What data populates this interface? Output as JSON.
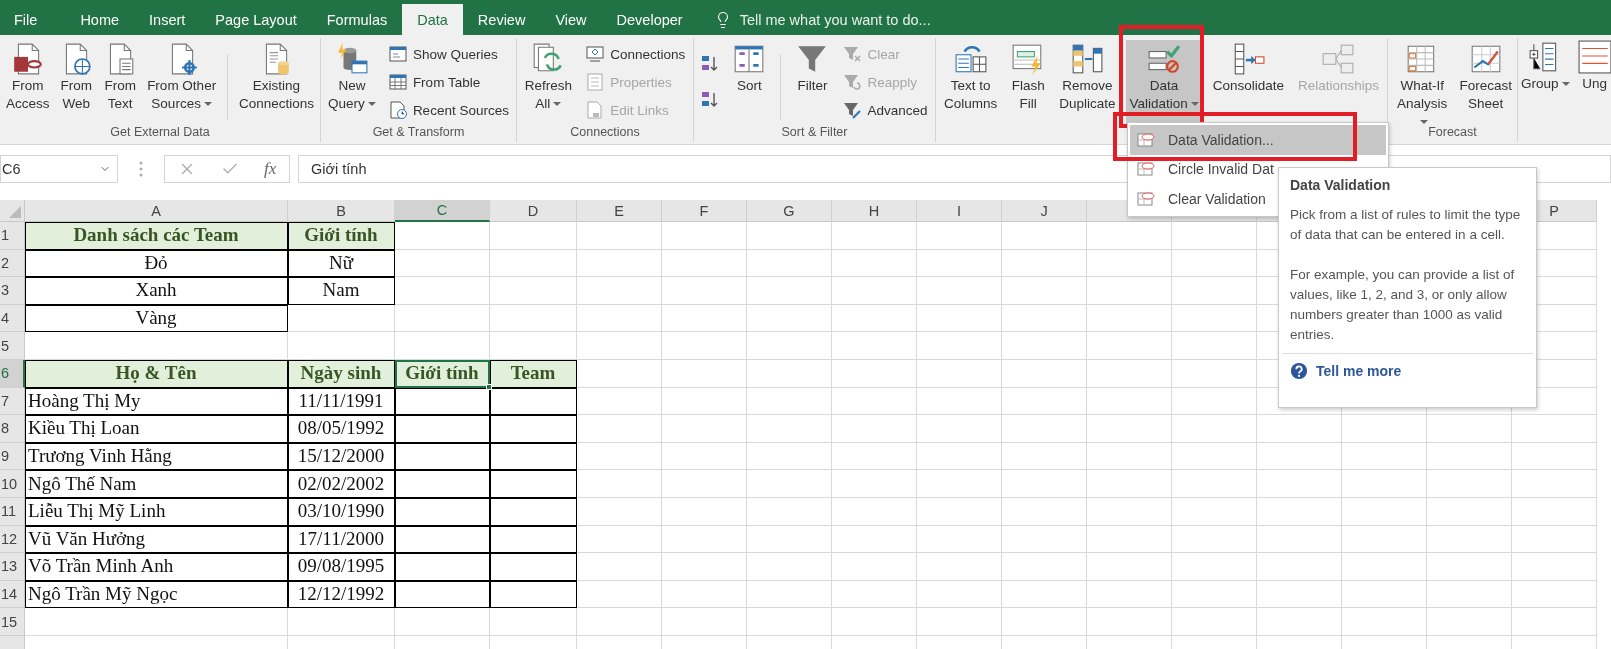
{
  "tabs": [
    {
      "label": "File",
      "selected": false
    },
    {
      "label": "Home",
      "selected": false
    },
    {
      "label": "Insert",
      "selected": false
    },
    {
      "label": "Page Layout",
      "selected": false
    },
    {
      "label": "Formulas",
      "selected": false
    },
    {
      "label": "Data",
      "selected": true
    },
    {
      "label": "Review",
      "selected": false
    },
    {
      "label": "View",
      "selected": false
    },
    {
      "label": "Developer",
      "selected": false
    }
  ],
  "tell_me": {
    "placeholder": "Tell me what you want to do..."
  },
  "ribbon": {
    "groups": [
      {
        "label": "Get External Data",
        "items": [
          {
            "kind": "large",
            "label": "From\nAccess",
            "dropdown": false,
            "disabled": false
          },
          {
            "kind": "large",
            "label": "From\nWeb",
            "dropdown": false,
            "disabled": false
          },
          {
            "kind": "large",
            "label": "From\nText",
            "dropdown": false,
            "disabled": false
          },
          {
            "kind": "large",
            "label": "From Other\nSources",
            "dropdown": true,
            "disabled": false
          },
          {
            "kind": "separator"
          },
          {
            "kind": "large",
            "label": "Existing\nConnections",
            "dropdown": false,
            "disabled": false
          }
        ]
      },
      {
        "label": "Get & Transform",
        "items": [
          {
            "kind": "large",
            "label": "New\nQuery",
            "dropdown": true,
            "disabled": false
          },
          {
            "kind": "stack",
            "items": [
              {
                "label": "Show Queries",
                "disabled": false
              },
              {
                "label": "From Table",
                "disabled": false
              },
              {
                "label": "Recent Sources",
                "disabled": false
              }
            ]
          }
        ]
      },
      {
        "label": "Connections",
        "items": [
          {
            "kind": "large",
            "label": "Refresh\nAll",
            "dropdown": true,
            "disabled": false
          },
          {
            "kind": "stack",
            "items": [
              {
                "label": "Connections",
                "disabled": false
              },
              {
                "label": "Properties",
                "disabled": true
              },
              {
                "label": "Edit Links",
                "disabled": true
              }
            ]
          }
        ]
      },
      {
        "label": "Sort & Filter",
        "items": [
          {
            "kind": "sort_pair"
          },
          {
            "kind": "large",
            "label": "Sort",
            "dropdown": false,
            "disabled": false
          },
          {
            "kind": "separator"
          },
          {
            "kind": "large",
            "label": "Filter",
            "dropdown": false,
            "disabled": false
          },
          {
            "kind": "stack",
            "items": [
              {
                "label": "Clear",
                "disabled": true
              },
              {
                "label": "Reapply",
                "disabled": true
              },
              {
                "label": "Advanced",
                "disabled": false
              }
            ]
          }
        ]
      },
      {
        "items": [
          {
            "kind": "large",
            "label": "Text to\nColumns",
            "dropdown": false,
            "disabled": false
          },
          {
            "kind": "large",
            "label": "Flash\nFill",
            "dropdown": false,
            "disabled": false
          },
          {
            "kind": "large",
            "label": "Remove\nDuplicate",
            "dropdown": false,
            "disabled": false
          },
          {
            "kind": "large",
            "label": "Data\nValidation",
            "dropdown": true,
            "disabled": false,
            "pressed": true,
            "annotated": true
          },
          {
            "kind": "large",
            "label": "Consolidate",
            "dropdown": false,
            "disabled": false
          },
          {
            "kind": "large",
            "label": "Relationships",
            "dropdown": false,
            "disabled": true
          }
        ]
      },
      {
        "label": "Forecast",
        "items": [
          {
            "kind": "large",
            "label": "What-If\nAnalysis",
            "dropdown": true,
            "disabled": false
          },
          {
            "kind": "large",
            "label": "Forecast\nSheet",
            "dropdown": false,
            "disabled": false
          }
        ]
      },
      {
        "items": [
          {
            "kind": "large",
            "label": "Group",
            "dropdown": true,
            "disabled": false
          },
          {
            "kind": "large",
            "label": "Ung",
            "dropdown": false,
            "disabled": false
          }
        ]
      }
    ]
  },
  "formula_bar": {
    "name_box": "C6",
    "fx_label": "fx",
    "value": "Giới tính"
  },
  "sheet": {
    "columns": [
      {
        "label": "A",
        "selected": false
      },
      {
        "label": "B",
        "selected": false
      },
      {
        "label": "C",
        "selected": true
      },
      {
        "label": "D",
        "selected": false
      },
      {
        "label": "E",
        "selected": false
      },
      {
        "label": "F",
        "selected": false
      },
      {
        "label": "G",
        "selected": false
      },
      {
        "label": "H",
        "selected": false
      },
      {
        "label": "I",
        "selected": false
      },
      {
        "label": "J",
        "selected": false
      },
      {},
      {},
      {},
      {},
      {},
      {
        "label": "P",
        "selected": false
      }
    ],
    "rows": [
      {
        "label": "1",
        "selected": false,
        "cells": [
          {
            "kind": "header",
            "text": "Danh sách các Team",
            "selected": false
          },
          {
            "kind": "header",
            "text": "Giới tính",
            "selected": false
          }
        ]
      },
      {
        "label": "2",
        "selected": false,
        "cells": [
          {
            "kind": "center",
            "text": "Đỏ",
            "selected": false
          },
          {
            "kind": "center",
            "text": "Nữ",
            "selected": false
          }
        ]
      },
      {
        "label": "3",
        "selected": false,
        "cells": [
          {
            "kind": "center",
            "text": "Xanh",
            "selected": false
          },
          {
            "kind": "center",
            "text": "Nam",
            "selected": false
          }
        ]
      },
      {
        "label": "4",
        "selected": false,
        "cells": [
          {
            "kind": "center",
            "text": "Vàng",
            "selected": false
          }
        ]
      },
      {
        "label": "5",
        "selected": false
      },
      {
        "label": "6",
        "selected": true,
        "cells": [
          {
            "kind": "header",
            "text": "Họ & Tên",
            "selected": false
          },
          {
            "kind": "header",
            "text": "Ngày sinh",
            "selected": false
          },
          {
            "kind": "header",
            "text": "Giới tính",
            "selected": true
          },
          {
            "kind": "header",
            "text": "Team",
            "selected": false
          }
        ]
      },
      {
        "label": "7",
        "selected": false,
        "cells": [
          {
            "kind": "left",
            "text": "Hoàng Thị My",
            "selected": false
          },
          {
            "kind": "center",
            "text": "11/11/1991",
            "selected": false
          },
          {
            "kind": "boxed",
            "selected": false
          },
          {
            "kind": "boxed",
            "selected": false
          }
        ]
      },
      {
        "label": "8",
        "selected": false,
        "cells": [
          {
            "kind": "left",
            "text": "Kiều Thị Loan",
            "selected": false
          },
          {
            "kind": "center",
            "text": "08/05/1992",
            "selected": false
          },
          {
            "kind": "boxed",
            "selected": false
          },
          {
            "kind": "boxed",
            "selected": false
          }
        ]
      },
      {
        "label": "9",
        "selected": false,
        "cells": [
          {
            "kind": "left",
            "text": "Trương Vinh Hằng",
            "selected": false
          },
          {
            "kind": "center",
            "text": "15/12/2000",
            "selected": false
          },
          {
            "kind": "boxed",
            "selected": false
          },
          {
            "kind": "boxed",
            "selected": false
          }
        ]
      },
      {
        "label": "10",
        "selected": false,
        "cells": [
          {
            "kind": "left",
            "text": "Ngô Thế Nam",
            "selected": false
          },
          {
            "kind": "center",
            "text": "02/02/2002",
            "selected": false
          },
          {
            "kind": "boxed",
            "selected": false
          },
          {
            "kind": "boxed",
            "selected": false
          }
        ]
      },
      {
        "label": "11",
        "selected": false,
        "cells": [
          {
            "kind": "left",
            "text": "Liễu Thị Mỹ Linh",
            "selected": false
          },
          {
            "kind": "center",
            "text": "03/10/1990",
            "selected": false
          },
          {
            "kind": "boxed",
            "selected": false
          },
          {
            "kind": "boxed",
            "selected": false
          }
        ]
      },
      {
        "label": "12",
        "selected": false,
        "cells": [
          {
            "kind": "left",
            "text": "Vũ Văn Hưởng",
            "selected": false
          },
          {
            "kind": "center",
            "text": "17/11/2000",
            "selected": false
          },
          {
            "kind": "boxed",
            "selected": false
          },
          {
            "kind": "boxed",
            "selected": false
          }
        ]
      },
      {
        "label": "13",
        "selected": false,
        "cells": [
          {
            "kind": "left",
            "text": "Võ Trần Minh Anh",
            "selected": false
          },
          {
            "kind": "center",
            "text": "09/08/1995",
            "selected": false
          },
          {
            "kind": "boxed",
            "selected": false
          },
          {
            "kind": "boxed",
            "selected": false
          }
        ]
      },
      {
        "label": "14",
        "selected": false,
        "cells": [
          {
            "kind": "left",
            "text": "Ngô Trần Mỹ Ngọc",
            "selected": false
          },
          {
            "kind": "center",
            "text": "12/12/1992",
            "selected": false
          },
          {
            "kind": "boxed",
            "selected": false
          },
          {
            "kind": "boxed",
            "selected": false
          }
        ]
      },
      {
        "label": "15",
        "selected": false
      },
      {
        "selected": false
      }
    ]
  },
  "dropdown_menu": {
    "items": [
      {
        "label": "Data Validation...",
        "hovered": true,
        "annotated": true
      },
      {
        "label": "Circle Invalid Dat",
        "hovered": false,
        "annotated": false
      },
      {
        "label": "Clear Validation",
        "hovered": false,
        "annotated": false
      }
    ]
  },
  "tooltip": {
    "title": "Data Validation",
    "paragraphs": [
      "Pick from a list of rules to limit the type of data that can be entered in a cell.",
      "For example, you can provide a list of values, like 1, 2, and 3, or only allow numbers greater than 1000 as valid entries."
    ],
    "link": "Tell me more"
  }
}
